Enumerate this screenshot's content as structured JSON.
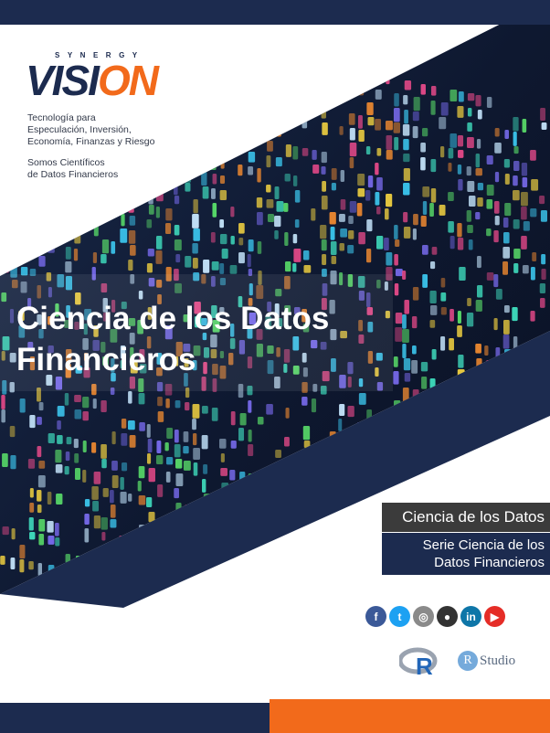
{
  "brand": {
    "synergy": "SYNERGY",
    "vision_dark": "VISI",
    "vision_orange": "ON",
    "tagline": "Tecnología para\nEspeculación, Inversión,\nEconomía, Finanzas y Riesgo",
    "scientists": "Somos Científicos\nde Datos Financieros"
  },
  "cover": {
    "title": "Ciencia de los Datos Financieros",
    "subject": "Ciencia de los Datos",
    "series": "Serie Ciencia de los\nDatos Financieros"
  },
  "social": [
    {
      "icon": "facebook-icon",
      "glyph": "f",
      "color": "#3b5998"
    },
    {
      "icon": "twitter-icon",
      "glyph": "t",
      "color": "#1da1f2"
    },
    {
      "icon": "instagram-icon",
      "glyph": "◎",
      "color": "#8a8a8a"
    },
    {
      "icon": "github-icon",
      "glyph": "●",
      "color": "#333333"
    },
    {
      "icon": "linkedin-icon",
      "glyph": "in",
      "color": "#0e76a8"
    },
    {
      "icon": "youtube-icon",
      "glyph": "▶",
      "color": "#e52d27"
    }
  ],
  "tools": {
    "r_letter": "R",
    "rstudio_badge": "R",
    "rstudio_word": "Studio"
  },
  "colors": {
    "navy": "#1c2b4f",
    "orange": "#f26a1b",
    "dark_gray": "#3b3b3b"
  }
}
